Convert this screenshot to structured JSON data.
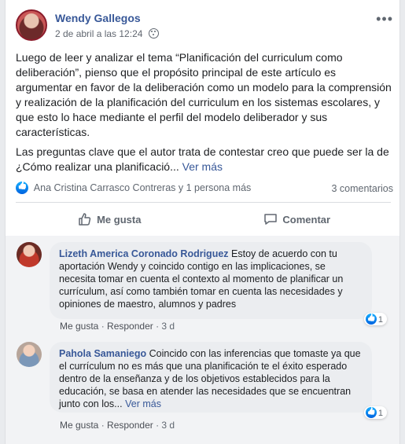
{
  "post": {
    "author": "Wendy Gallegos",
    "timestamp": "2 de abril a las 12:24",
    "privacy_icon": "friends-icon",
    "more_label": "•••",
    "paragraph1": "Luego de leer y analizar el tema “Planificación del curriculum como deliberación”, pienso que el propósito principal de este artículo es argumentar en favor de la deliberación como un modelo para la comprensión y realización de la planificación del curriculum en los sistemas escolares, y que esto lo hace mediante el perfil del modelo deliberador y sus características.",
    "paragraph2": "Las preguntas clave que el autor trata de contestar creo que puede ser la de ¿Cómo realizar una planificació...",
    "see_more": "Ver más"
  },
  "reactions": {
    "summary": "Ana Cristina Carrasco Contreras y 1 persona más",
    "comments_count": "3 comentarios"
  },
  "actions": {
    "like": "Me gusta",
    "comment": "Comentar"
  },
  "comments": [
    {
      "author": "Lizeth America Coronado Rodriguez",
      "text": "Estoy de acuerdo con tu aportación Wendy y coincido contigo en las implicaciones, se necesita tomar en cuenta el contexto al momento de planificar un currículum, así como también tomar en cuenta las necesidades y opiniones de maestro, alumnos y padres",
      "like_label": "Me gusta",
      "reply_label": "Responder",
      "age": "3 d",
      "likes": "1"
    },
    {
      "author": "Pahola Samaniego",
      "text": "Coincido con las inferencias que tomaste ya que el currículum no es más que una planificación te el éxito esperado dentro de la enseñanza y de los objetivos establecidos para la educación, se basa en atender las necesidades que se encuentran junto con los...",
      "see_more": "Ver más",
      "like_label": "Me gusta",
      "reply_label": "Responder",
      "age": "3 d",
      "likes": "1"
    }
  ],
  "colors": {
    "link": "#385898",
    "like_blue": "#1877f2",
    "meta": "#606770"
  }
}
